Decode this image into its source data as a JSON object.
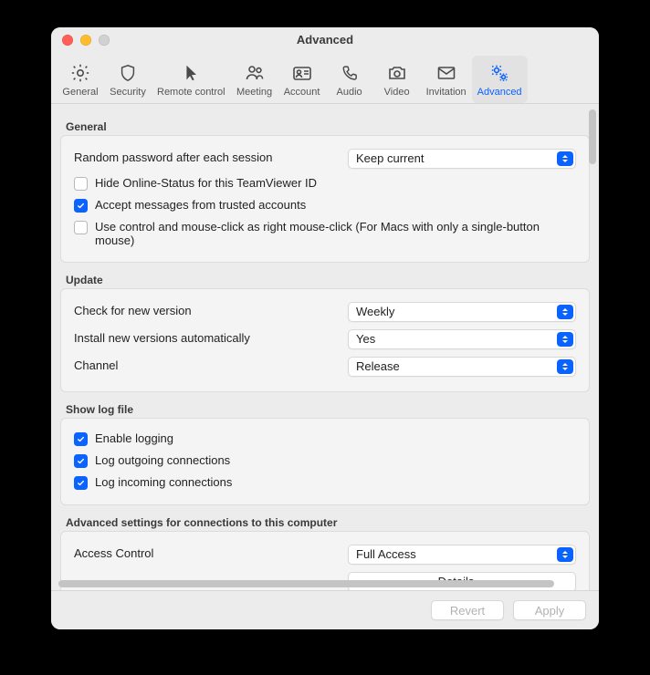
{
  "window": {
    "title": "Advanced"
  },
  "toolbar": {
    "items": [
      {
        "label": "General"
      },
      {
        "label": "Security"
      },
      {
        "label": "Remote control"
      },
      {
        "label": "Meeting"
      },
      {
        "label": "Account"
      },
      {
        "label": "Audio"
      },
      {
        "label": "Video"
      },
      {
        "label": "Invitation"
      },
      {
        "label": "Advanced"
      }
    ],
    "active_index": 8
  },
  "sections": {
    "general": {
      "heading": "General",
      "random_password_label": "Random password after each session",
      "random_password_value": "Keep current",
      "hide_online_status": {
        "label": "Hide Online-Status for this TeamViewer ID",
        "checked": false
      },
      "accept_trusted": {
        "label": "Accept messages from trusted accounts",
        "checked": true
      },
      "right_click_emulate": {
        "label": "Use control and mouse-click as right mouse-click (For Macs with only a single-button mouse)",
        "checked": false
      }
    },
    "update": {
      "heading": "Update",
      "check_version": {
        "label": "Check for new version",
        "value": "Weekly"
      },
      "install_auto": {
        "label": "Install new versions automatically",
        "value": "Yes"
      },
      "channel": {
        "label": "Channel",
        "value": "Release"
      }
    },
    "log": {
      "heading": "Show log file",
      "enable_logging": {
        "label": "Enable logging",
        "checked": true
      },
      "log_outgoing": {
        "label": "Log outgoing connections",
        "checked": true
      },
      "log_incoming": {
        "label": "Log incoming connections",
        "checked": true
      }
    },
    "access": {
      "heading": "Advanced settings for connections to this computer",
      "access_control": {
        "label": "Access Control",
        "value": "Full Access"
      },
      "details_button": "Details…"
    }
  },
  "footer": {
    "revert": "Revert",
    "apply": "Apply"
  }
}
